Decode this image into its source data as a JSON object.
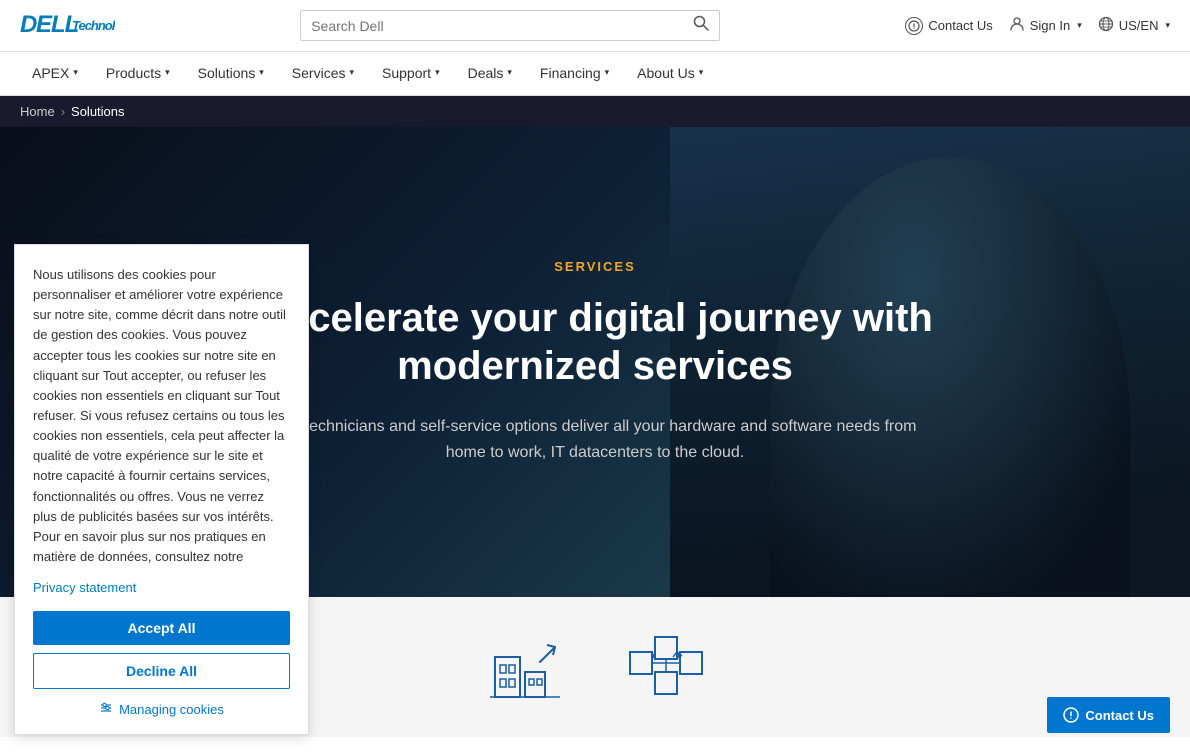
{
  "header": {
    "logo_dell": "D’LL",
    "logo_dell_styled": "DELL",
    "logo_tech": "Technologies",
    "search_placeholder": "Search Dell",
    "contact_us": "Contact Us",
    "sign_in": "Sign In",
    "locale": "US/EN"
  },
  "nav": {
    "items": [
      {
        "label": "APEX",
        "has_dropdown": true
      },
      {
        "label": "Products",
        "has_dropdown": true
      },
      {
        "label": "Solutions",
        "has_dropdown": true
      },
      {
        "label": "Services",
        "has_dropdown": true
      },
      {
        "label": "Support",
        "has_dropdown": true
      },
      {
        "label": "Deals",
        "has_dropdown": true
      },
      {
        "label": "Financing",
        "has_dropdown": true
      },
      {
        "label": "About Us",
        "has_dropdown": true
      }
    ]
  },
  "breadcrumb": {
    "home": "Home",
    "separator": "›",
    "current": "Solutions"
  },
  "hero": {
    "label": "SERVICES",
    "title": "Accelerate your digital journey with modernized services",
    "subtitle": "Our technicians and self-service options deliver all your hardware and software needs from home to work, IT datacenters to the cloud."
  },
  "cookie": {
    "text": "Nous utilisons des cookies pour personnaliser et améliorer votre expérience sur notre site, comme décrit dans notre outil de gestion des cookies. Vous pouvez accepter tous les cookies sur notre site en cliquant sur Tout accepter, ou refuser les cookies non essentiels en cliquant sur Tout refuser. Si vous refusez certains ou tous les cookies non essentiels, cela peut affecter la qualité de votre expérience sur le site et notre capacité à fournir certains services, fonctionnalités ou offres. Vous ne verrez plus de publicités basées sur vos intérêts. Pour en savoir plus sur nos pratiques en matière de données, consultez notre",
    "privacy_link": "Privacy statement",
    "accept_btn": "Accept All",
    "decline_btn": "Decline All",
    "manage_link": "Managing cookies"
  },
  "contact_bottom": "Contact Us"
}
